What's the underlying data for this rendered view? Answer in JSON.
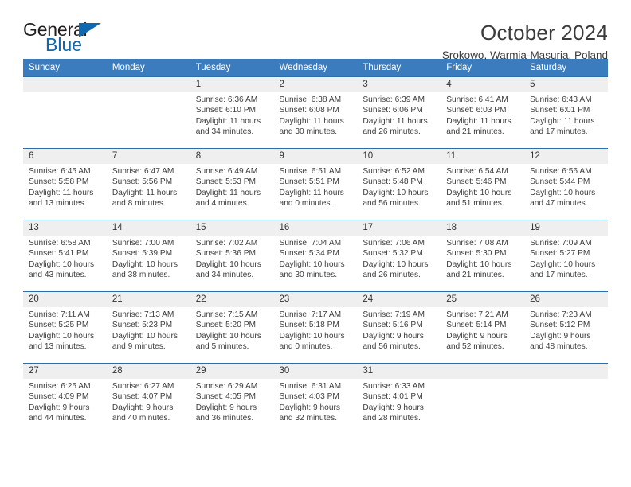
{
  "brand": {
    "line1": "General",
    "line2": "Blue",
    "flag_icon": "triangle-flag-icon",
    "accent_color": "#1068b0"
  },
  "header": {
    "title": "October 2024",
    "subtitle": "Srokowo, Warmia-Masuria, Poland"
  },
  "theme": {
    "header_row_bg": "#3b7cbe",
    "row_divider": "#2f6da8",
    "daynum_bg": "#efefef",
    "text": "#3d3d3d"
  },
  "weekday_headers": [
    "Sunday",
    "Monday",
    "Tuesday",
    "Wednesday",
    "Thursday",
    "Friday",
    "Saturday"
  ],
  "labels": {
    "sunrise_prefix": "Sunrise:",
    "sunset_prefix": "Sunset:",
    "daylight_prefix": "Daylight:"
  },
  "weeks": [
    [
      {
        "day": "",
        "sunrise": "",
        "sunset": "",
        "daylight_l1": "",
        "daylight_l2": ""
      },
      {
        "day": "",
        "sunrise": "",
        "sunset": "",
        "daylight_l1": "",
        "daylight_l2": ""
      },
      {
        "day": "1",
        "sunrise": "Sunrise: 6:36 AM",
        "sunset": "Sunset: 6:10 PM",
        "daylight_l1": "Daylight: 11 hours",
        "daylight_l2": "and 34 minutes."
      },
      {
        "day": "2",
        "sunrise": "Sunrise: 6:38 AM",
        "sunset": "Sunset: 6:08 PM",
        "daylight_l1": "Daylight: 11 hours",
        "daylight_l2": "and 30 minutes."
      },
      {
        "day": "3",
        "sunrise": "Sunrise: 6:39 AM",
        "sunset": "Sunset: 6:06 PM",
        "daylight_l1": "Daylight: 11 hours",
        "daylight_l2": "and 26 minutes."
      },
      {
        "day": "4",
        "sunrise": "Sunrise: 6:41 AM",
        "sunset": "Sunset: 6:03 PM",
        "daylight_l1": "Daylight: 11 hours",
        "daylight_l2": "and 21 minutes."
      },
      {
        "day": "5",
        "sunrise": "Sunrise: 6:43 AM",
        "sunset": "Sunset: 6:01 PM",
        "daylight_l1": "Daylight: 11 hours",
        "daylight_l2": "and 17 minutes."
      }
    ],
    [
      {
        "day": "6",
        "sunrise": "Sunrise: 6:45 AM",
        "sunset": "Sunset: 5:58 PM",
        "daylight_l1": "Daylight: 11 hours",
        "daylight_l2": "and 13 minutes."
      },
      {
        "day": "7",
        "sunrise": "Sunrise: 6:47 AM",
        "sunset": "Sunset: 5:56 PM",
        "daylight_l1": "Daylight: 11 hours",
        "daylight_l2": "and 8 minutes."
      },
      {
        "day": "8",
        "sunrise": "Sunrise: 6:49 AM",
        "sunset": "Sunset: 5:53 PM",
        "daylight_l1": "Daylight: 11 hours",
        "daylight_l2": "and 4 minutes."
      },
      {
        "day": "9",
        "sunrise": "Sunrise: 6:51 AM",
        "sunset": "Sunset: 5:51 PM",
        "daylight_l1": "Daylight: 11 hours",
        "daylight_l2": "and 0 minutes."
      },
      {
        "day": "10",
        "sunrise": "Sunrise: 6:52 AM",
        "sunset": "Sunset: 5:48 PM",
        "daylight_l1": "Daylight: 10 hours",
        "daylight_l2": "and 56 minutes."
      },
      {
        "day": "11",
        "sunrise": "Sunrise: 6:54 AM",
        "sunset": "Sunset: 5:46 PM",
        "daylight_l1": "Daylight: 10 hours",
        "daylight_l2": "and 51 minutes."
      },
      {
        "day": "12",
        "sunrise": "Sunrise: 6:56 AM",
        "sunset": "Sunset: 5:44 PM",
        "daylight_l1": "Daylight: 10 hours",
        "daylight_l2": "and 47 minutes."
      }
    ],
    [
      {
        "day": "13",
        "sunrise": "Sunrise: 6:58 AM",
        "sunset": "Sunset: 5:41 PM",
        "daylight_l1": "Daylight: 10 hours",
        "daylight_l2": "and 43 minutes."
      },
      {
        "day": "14",
        "sunrise": "Sunrise: 7:00 AM",
        "sunset": "Sunset: 5:39 PM",
        "daylight_l1": "Daylight: 10 hours",
        "daylight_l2": "and 38 minutes."
      },
      {
        "day": "15",
        "sunrise": "Sunrise: 7:02 AM",
        "sunset": "Sunset: 5:36 PM",
        "daylight_l1": "Daylight: 10 hours",
        "daylight_l2": "and 34 minutes."
      },
      {
        "day": "16",
        "sunrise": "Sunrise: 7:04 AM",
        "sunset": "Sunset: 5:34 PM",
        "daylight_l1": "Daylight: 10 hours",
        "daylight_l2": "and 30 minutes."
      },
      {
        "day": "17",
        "sunrise": "Sunrise: 7:06 AM",
        "sunset": "Sunset: 5:32 PM",
        "daylight_l1": "Daylight: 10 hours",
        "daylight_l2": "and 26 minutes."
      },
      {
        "day": "18",
        "sunrise": "Sunrise: 7:08 AM",
        "sunset": "Sunset: 5:30 PM",
        "daylight_l1": "Daylight: 10 hours",
        "daylight_l2": "and 21 minutes."
      },
      {
        "day": "19",
        "sunrise": "Sunrise: 7:09 AM",
        "sunset": "Sunset: 5:27 PM",
        "daylight_l1": "Daylight: 10 hours",
        "daylight_l2": "and 17 minutes."
      }
    ],
    [
      {
        "day": "20",
        "sunrise": "Sunrise: 7:11 AM",
        "sunset": "Sunset: 5:25 PM",
        "daylight_l1": "Daylight: 10 hours",
        "daylight_l2": "and 13 minutes."
      },
      {
        "day": "21",
        "sunrise": "Sunrise: 7:13 AM",
        "sunset": "Sunset: 5:23 PM",
        "daylight_l1": "Daylight: 10 hours",
        "daylight_l2": "and 9 minutes."
      },
      {
        "day": "22",
        "sunrise": "Sunrise: 7:15 AM",
        "sunset": "Sunset: 5:20 PM",
        "daylight_l1": "Daylight: 10 hours",
        "daylight_l2": "and 5 minutes."
      },
      {
        "day": "23",
        "sunrise": "Sunrise: 7:17 AM",
        "sunset": "Sunset: 5:18 PM",
        "daylight_l1": "Daylight: 10 hours",
        "daylight_l2": "and 0 minutes."
      },
      {
        "day": "24",
        "sunrise": "Sunrise: 7:19 AM",
        "sunset": "Sunset: 5:16 PM",
        "daylight_l1": "Daylight: 9 hours",
        "daylight_l2": "and 56 minutes."
      },
      {
        "day": "25",
        "sunrise": "Sunrise: 7:21 AM",
        "sunset": "Sunset: 5:14 PM",
        "daylight_l1": "Daylight: 9 hours",
        "daylight_l2": "and 52 minutes."
      },
      {
        "day": "26",
        "sunrise": "Sunrise: 7:23 AM",
        "sunset": "Sunset: 5:12 PM",
        "daylight_l1": "Daylight: 9 hours",
        "daylight_l2": "and 48 minutes."
      }
    ],
    [
      {
        "day": "27",
        "sunrise": "Sunrise: 6:25 AM",
        "sunset": "Sunset: 4:09 PM",
        "daylight_l1": "Daylight: 9 hours",
        "daylight_l2": "and 44 minutes."
      },
      {
        "day": "28",
        "sunrise": "Sunrise: 6:27 AM",
        "sunset": "Sunset: 4:07 PM",
        "daylight_l1": "Daylight: 9 hours",
        "daylight_l2": "and 40 minutes."
      },
      {
        "day": "29",
        "sunrise": "Sunrise: 6:29 AM",
        "sunset": "Sunset: 4:05 PM",
        "daylight_l1": "Daylight: 9 hours",
        "daylight_l2": "and 36 minutes."
      },
      {
        "day": "30",
        "sunrise": "Sunrise: 6:31 AM",
        "sunset": "Sunset: 4:03 PM",
        "daylight_l1": "Daylight: 9 hours",
        "daylight_l2": "and 32 minutes."
      },
      {
        "day": "31",
        "sunrise": "Sunrise: 6:33 AM",
        "sunset": "Sunset: 4:01 PM",
        "daylight_l1": "Daylight: 9 hours",
        "daylight_l2": "and 28 minutes."
      },
      {
        "day": "",
        "sunrise": "",
        "sunset": "",
        "daylight_l1": "",
        "daylight_l2": ""
      },
      {
        "day": "",
        "sunrise": "",
        "sunset": "",
        "daylight_l1": "",
        "daylight_l2": ""
      }
    ]
  ]
}
